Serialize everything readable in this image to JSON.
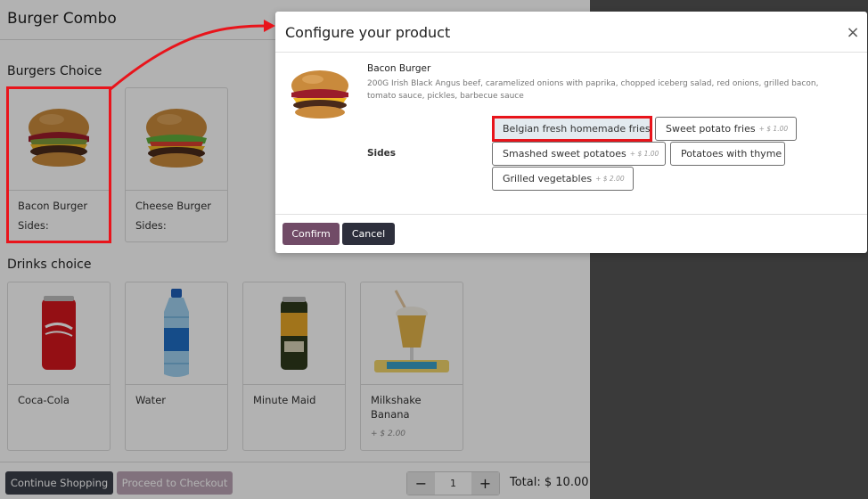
{
  "page": {
    "title": "Burger Combo",
    "burgers_section": "Burgers Choice",
    "drinks_section": "Drinks choice",
    "burgers": [
      {
        "name": "Bacon Burger",
        "sides": "Sides:"
      },
      {
        "name": "Cheese Burger",
        "sides": "Sides:"
      }
    ],
    "drinks": [
      {
        "name": "Coca-Cola",
        "extra": ""
      },
      {
        "name": "Water",
        "extra": ""
      },
      {
        "name": "Minute Maid",
        "extra": ""
      },
      {
        "name": "Milkshake Banana",
        "extra": "+ $ 2.00"
      }
    ],
    "footer": {
      "continue_label": "Continue Shopping",
      "checkout_label": "Proceed to Checkout",
      "minus": "−",
      "quantity": "1",
      "plus": "+",
      "total": "Total: $ 10.00"
    }
  },
  "modal": {
    "title": "Configure your product",
    "close": "×",
    "product_name": "Bacon Burger",
    "description": "200G Irish Black Angus beef, caramelized onions with paprika, chopped iceberg salad, red onions, grilled bacon, tomato sauce, pickles, barbecue sauce",
    "sides_label": "Sides",
    "options": [
      {
        "label": "Belgian fresh homemade fries",
        "extra": "",
        "selected": true
      },
      {
        "label": "Sweet potato fries",
        "extra": "+ $ 1.00",
        "selected": false
      },
      {
        "label": "Smashed sweet potatoes",
        "extra": "+ $ 1.00",
        "selected": false
      },
      {
        "label": "Potatoes with thyme",
        "extra": "",
        "selected": false
      },
      {
        "label": "Grilled vegetables",
        "extra": "+ $ 2.00",
        "selected": false
      }
    ],
    "confirm_label": "Confirm",
    "cancel_label": "Cancel"
  },
  "colors": {
    "primary": "#714b67",
    "dark_button": "#2d2f3c",
    "annotation": "#e8141b"
  }
}
